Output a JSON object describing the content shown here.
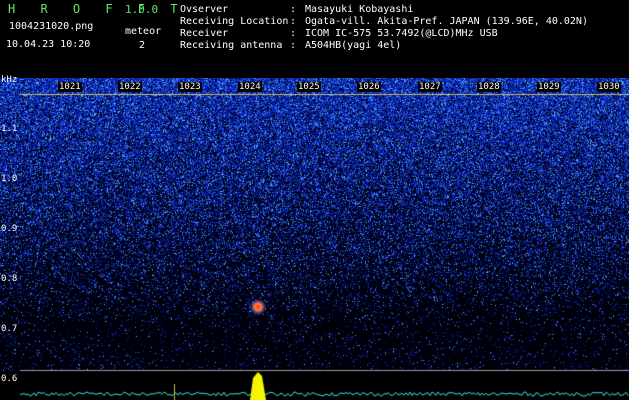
{
  "header": {
    "title": "H R O F F T",
    "version": "1.0.0",
    "filename": "1004231020.png",
    "datetime": "10.04.23 10:20",
    "meteor_label": "meteor",
    "meteor_count": "2"
  },
  "info": [
    {
      "label": "Ovserver",
      "value": "Masayuki Kobayashi"
    },
    {
      "label": "Receiving Location",
      "value": "Ogata-vill. Akita-Pref. JAPAN (139.96E, 40.02N)"
    },
    {
      "label": "Receiver",
      "value": "ICOM IC-575 53.7492(@LCD)MHz USB"
    },
    {
      "label": "Receiving antenna",
      "value": "A504HB(yagi 4el)"
    }
  ],
  "colors": {
    "title_green": "#66e36a",
    "bg": "#000000",
    "cursor_line": "#c9c06a"
  },
  "chart_data": {
    "type": "heatmap",
    "yunit": "kHz",
    "x_ticks": [
      "1021",
      "1022",
      "1023",
      "1024",
      "1025",
      "1026",
      "1027",
      "1028",
      "1029",
      "1030"
    ],
    "y_ticks": [
      "1.1",
      "1.0",
      "0.9",
      "0.8",
      "0.7",
      "0.6"
    ],
    "meteor_echo": {
      "x": "1024",
      "y": 0.75
    }
  }
}
